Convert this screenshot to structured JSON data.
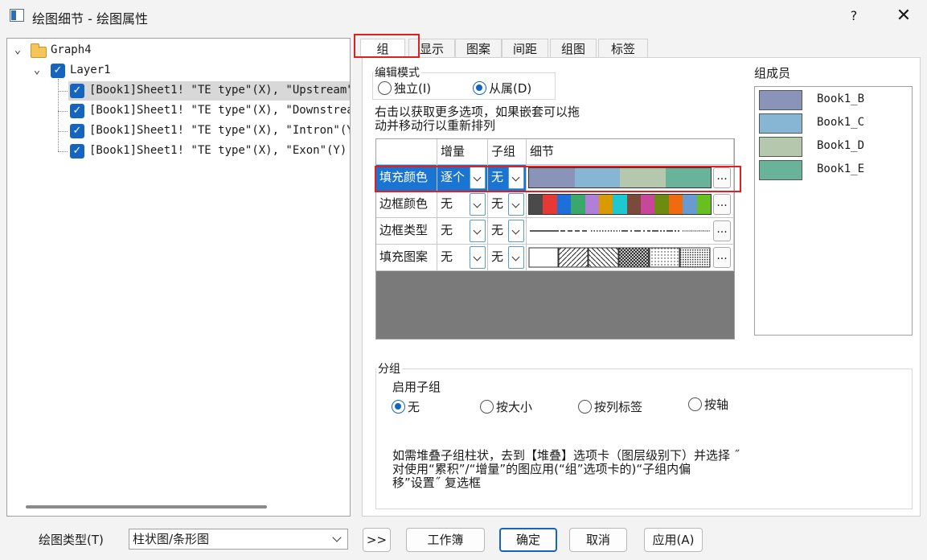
{
  "window": {
    "title": "绘图细节 - 绘图属性",
    "help_label": "?",
    "close_label": "✕"
  },
  "tree": {
    "graph": "Graph4",
    "layer": "Layer1",
    "plots": [
      "[Book1]Sheet1! \"TE type\"(X), \"Upstream\"(",
      "[Book1]Sheet1! \"TE type\"(X), \"Downstream",
      "[Book1]Sheet1! \"TE type\"(X), \"Intron\"(Y)",
      "[Book1]Sheet1! \"TE type\"(X), \"Exon\"(Y) ["
    ]
  },
  "tabs": [
    "组",
    "显示",
    "图案",
    "间距",
    "组图",
    "标签"
  ],
  "edit_mode": {
    "legend": "编辑模式",
    "options": [
      "独立(I)",
      "从属(D)"
    ],
    "selected": "从属(D)"
  },
  "hint": [
    "右击以获取更多选项，如果嵌套可以拖",
    "动并移动行以重新排列"
  ],
  "grid": {
    "headers": [
      "",
      "增量",
      "子组",
      "细节"
    ],
    "rows": [
      {
        "name": "填充颜色",
        "increment": "逐个",
        "subgroup": "无"
      },
      {
        "name": "边框颜色",
        "increment": "无",
        "subgroup": "无"
      },
      {
        "name": "边框类型",
        "increment": "无",
        "subgroup": "无"
      },
      {
        "name": "填充图案",
        "increment": "无",
        "subgroup": "无"
      }
    ],
    "ellipsis": "...",
    "fill_colors": [
      "#8a94b8",
      "#87b6d4",
      "#b5c8ad",
      "#68b39a"
    ],
    "border_colors": [
      "#4a4a4a",
      "#e53935",
      "#1e6fd9",
      "#3aa86b",
      "#b080d8",
      "#d99a00",
      "#1ec8d0",
      "#7a4a3a",
      "#c8479a",
      "#6e8a10",
      "#f06a10",
      "#6a9bd0",
      "#6abf20"
    ]
  },
  "members": {
    "label": "组成员",
    "items": [
      {
        "name": "Book1_B",
        "color": "#8a94b8"
      },
      {
        "name": "Book1_C",
        "color": "#87b6d4"
      },
      {
        "name": "Book1_D",
        "color": "#b5c8ad"
      },
      {
        "name": "Book1_E",
        "color": "#68b39a"
      }
    ]
  },
  "grouping": {
    "legend": "分组",
    "enable_label": "启用子组",
    "options": [
      "无",
      "按大小",
      "按列标签",
      "按轴"
    ],
    "selected": "无",
    "note": [
      "如需堆叠子组柱状，去到【堆叠】选项卡（图层级别下）并选择 ˝",
      "对使用“累积”/“增量”的图应用(“组”选项卡的)“子组内偏",
      "移”设置˝ 复选框"
    ]
  },
  "bottom": {
    "plot_type_label": "绘图类型(T)",
    "plot_type_value": "柱状图/条形图",
    "expand_label": ">>",
    "workbook_label": "工作簿",
    "ok_label": "确定",
    "cancel_label": "取消",
    "apply_label": "应用(A)"
  }
}
